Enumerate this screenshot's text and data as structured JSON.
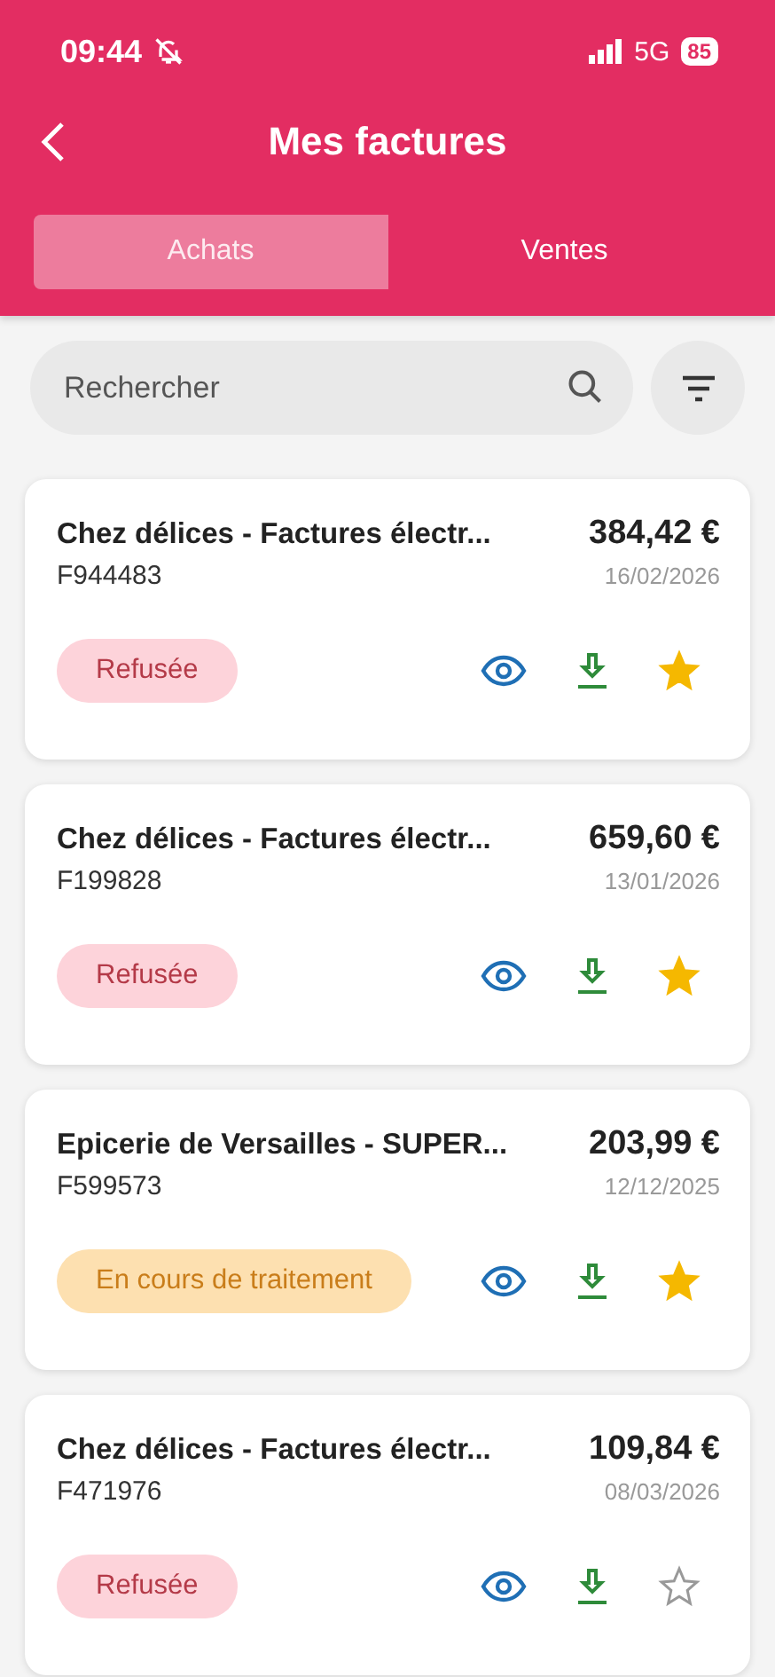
{
  "status_bar": {
    "time": "09:44",
    "network": "5G",
    "battery": "85"
  },
  "header": {
    "title": "Mes factures"
  },
  "tabs": [
    {
      "label": "Achats",
      "selected": true
    },
    {
      "label": "Ventes",
      "selected": false
    }
  ],
  "search": {
    "placeholder": "Rechercher"
  },
  "invoices": [
    {
      "title": "Chez délices - Factures électr...",
      "number": "F944483",
      "amount": "384,42 €",
      "date": "16/02/2026",
      "status": {
        "kind": "refused",
        "label": "Refusée"
      },
      "starred": true
    },
    {
      "title": "Chez délices - Factures électr...",
      "number": "F199828",
      "amount": "659,60 €",
      "date": "13/01/2026",
      "status": {
        "kind": "refused",
        "label": "Refusée"
      },
      "starred": true
    },
    {
      "title": "Epicerie de Versailles - SUPER...",
      "number": "F599573",
      "amount": "203,99 €",
      "date": "12/12/2025",
      "status": {
        "kind": "processing",
        "label": "En cours de traitement"
      },
      "starred": true
    },
    {
      "title": "Chez délices - Factures électr...",
      "number": "F471976",
      "amount": "109,84 €",
      "date": "08/03/2026",
      "status": {
        "kind": "refused",
        "label": "Refusée"
      },
      "starred": false
    }
  ]
}
